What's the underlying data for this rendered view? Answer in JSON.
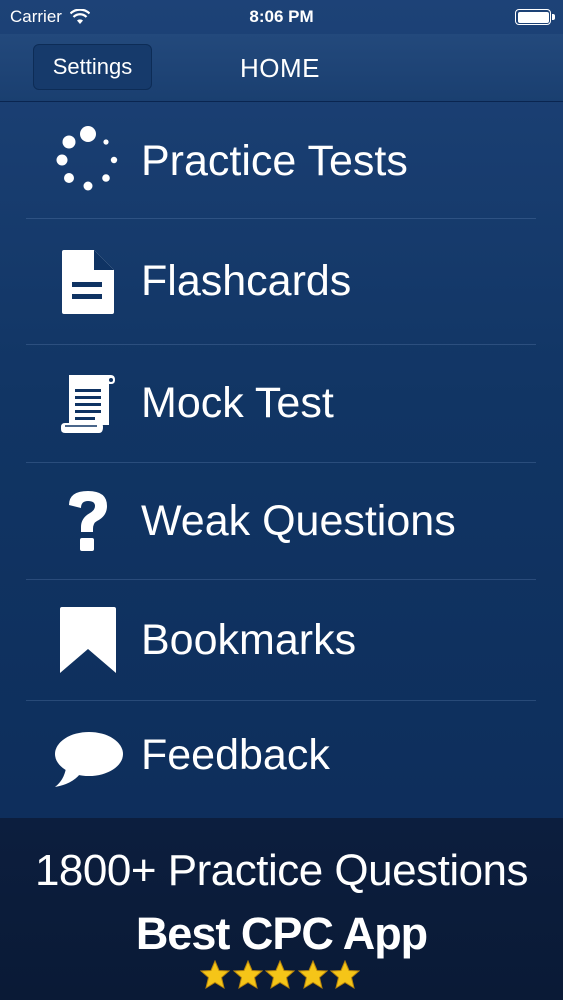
{
  "status_bar": {
    "carrier": "Carrier",
    "time": "8:06 PM",
    "battery_icon": "battery-full-icon",
    "wifi_icon": "wifi-icon"
  },
  "nav_bar": {
    "settings_label": "Settings",
    "title": "HOME"
  },
  "menu": {
    "items": [
      {
        "label": "Practice Tests",
        "icon": "loading-spinner-icon"
      },
      {
        "label": "Flashcards",
        "icon": "document-icon"
      },
      {
        "label": "Mock Test",
        "icon": "scroll-icon"
      },
      {
        "label": "Weak Questions",
        "icon": "question-mark-icon"
      },
      {
        "label": "Bookmarks",
        "icon": "bookmark-icon"
      },
      {
        "label": "Feedback",
        "icon": "speech-bubble-icon"
      }
    ]
  },
  "promo": {
    "line1": "1800+ Practice Questions",
    "line2": "Best CPC App",
    "rating_stars": 5,
    "star_color": "#f5c518"
  },
  "colors": {
    "background": "#113564",
    "nav_bar": "#1a3f70",
    "promo_background": "#0a1a36",
    "text": "#ffffff"
  }
}
